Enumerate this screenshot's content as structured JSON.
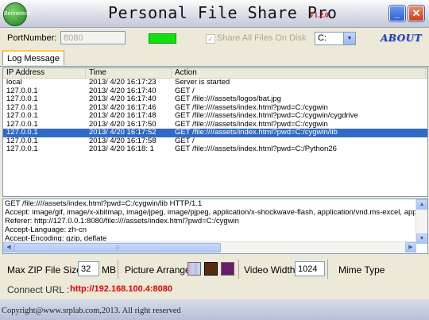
{
  "window": {
    "logo_text": "Bennetech",
    "title": "Personal File Share Pro",
    "version": "V1.2.0",
    "minimize_glyph": "_",
    "close_glyph": "✕"
  },
  "toolbar": {
    "port_label": "PortNumber:",
    "port_value": "8080",
    "status_color": "#10e010",
    "share_all_label": "Share All Files On Disk",
    "share_all_checked": true,
    "disk_value": "C:",
    "about_label": "ABOUT"
  },
  "tabs": [
    {
      "label": "Log Message",
      "active": true
    }
  ],
  "log": {
    "columns": [
      "IP Address",
      "Time",
      "Action"
    ],
    "rows": [
      {
        "ip": "local",
        "time": "2013/ 4/20 16:17:23",
        "action": "Server is started",
        "selected": false
      },
      {
        "ip": "127.0.0.1",
        "time": "2013/ 4/20 16:17:40",
        "action": "GET /",
        "selected": false
      },
      {
        "ip": "127.0.0.1",
        "time": "2013/ 4/20 16:17:40",
        "action": "GET /file:////assets/logos/bat.jpg",
        "selected": false
      },
      {
        "ip": "127.0.0.1",
        "time": "2013/ 4/20 16:17:46",
        "action": "GET /file:////assets/index.html?pwd=C:/cygwin",
        "selected": false
      },
      {
        "ip": "127.0.0.1",
        "time": "2013/ 4/20 16:17:48",
        "action": "GET /file:////assets/index.html?pwd=C:/cygwin/cygdrive",
        "selected": false
      },
      {
        "ip": "127.0.0.1",
        "time": "2013/ 4/20 16:17:50",
        "action": "GET /file:////assets/index.html?pwd=C:/cygwin",
        "selected": false
      },
      {
        "ip": "127.0.0.1",
        "time": "2013/ 4/20 16:17:52",
        "action": "GET /file:////assets/index.html?pwd=C:/cygwin/lib",
        "selected": true
      },
      {
        "ip": "127.0.0.1",
        "time": "2013/ 4/20 16:17:58",
        "action": "GET /",
        "selected": false
      },
      {
        "ip": "127.0.0.1",
        "time": "2013/ 4/20 16:18: 1",
        "action": "GET /file:////assets/index.html?pwd=C:/Python26",
        "selected": false
      }
    ]
  },
  "request_detail": [
    "GET /file:////assets/index.html?pwd=C:/cygwin/lib HTTP/1.1",
    "Accept: image/gif, image/x-xbitmap, image/jpeg, image/pjpeg, application/x-shockwave-flash, application/vnd.ms-excel, applicatic",
    "Referer: http://127.0.0.1:8080/file:////assets/index.html?pwd=C:/cygwin",
    "Accept-Language: zh-cn",
    "Accept-Encoding: gzip, deflate"
  ],
  "options": {
    "zip_label": "Max ZIP File Size:",
    "zip_value": "32",
    "zip_unit": "MB",
    "arrange_label": "Picture Arrange:",
    "arrange_colors": [
      "#e8a8e0",
      "#5a2a10",
      "#6a1a6a"
    ],
    "video_label": "Video Width:",
    "video_value": "1024",
    "mime_label": "Mime Type"
  },
  "connect": {
    "label": "Connect URL :",
    "url": "http://192.168.100.4:8080"
  },
  "footer": {
    "copyright": "Copyright@www.srplab.com,2013. All right reserved"
  }
}
